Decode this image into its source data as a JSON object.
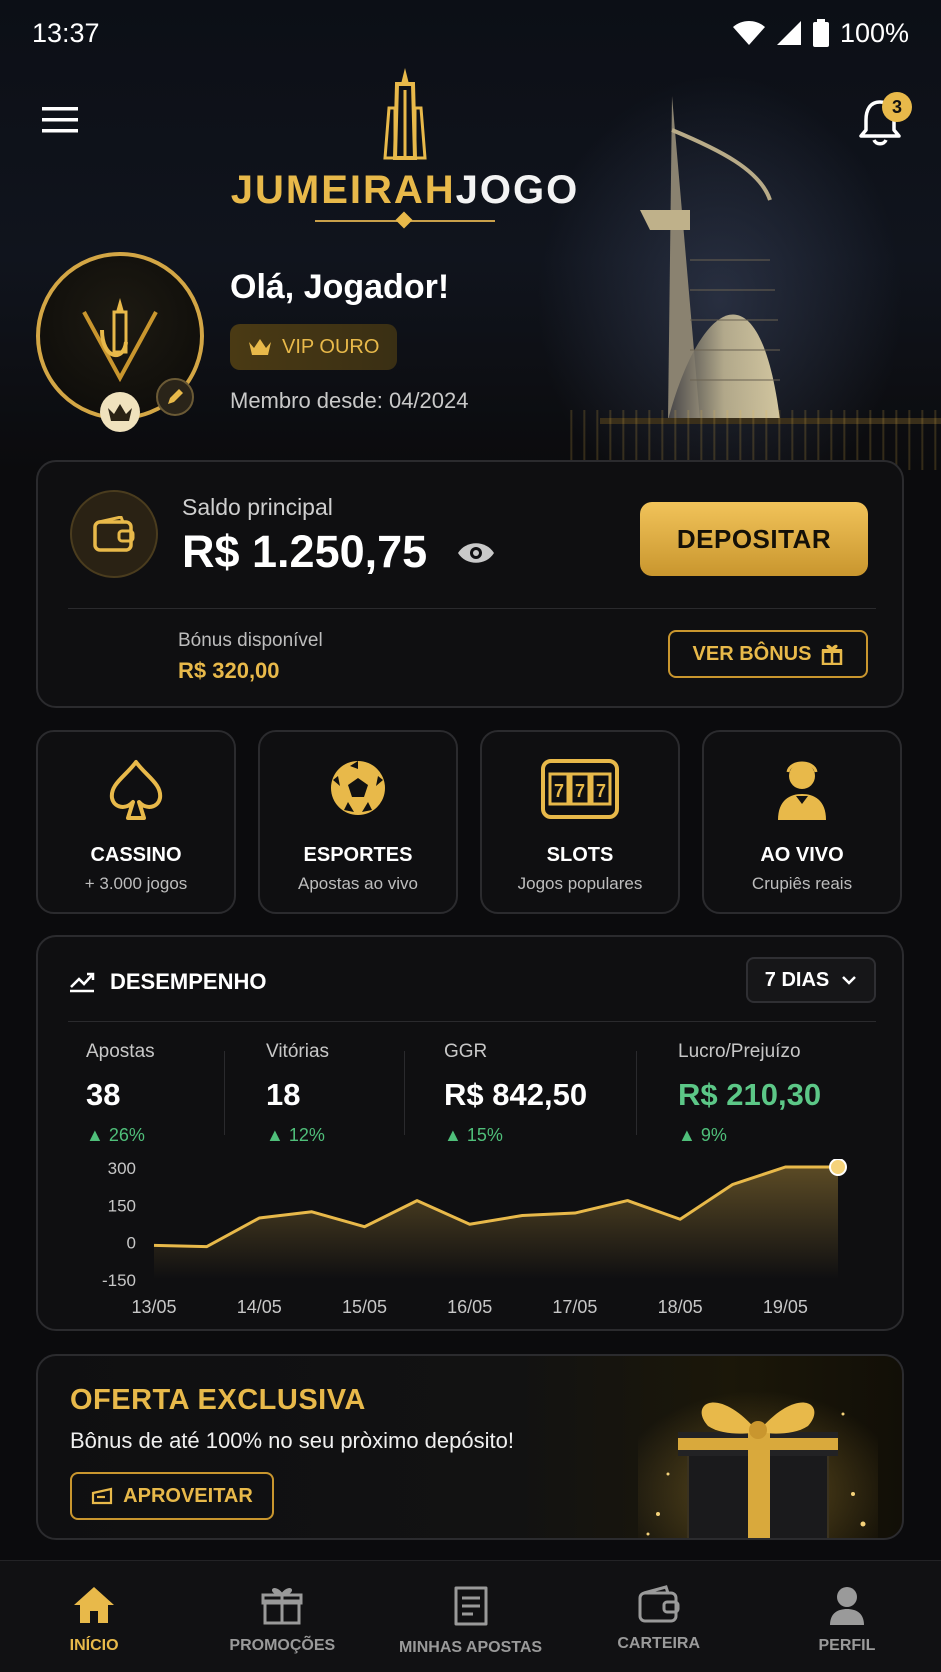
{
  "status_bar": {
    "time": "13:37",
    "battery": "100%"
  },
  "header": {
    "logo_part1": "JUMEIRAH",
    "logo_part2": "JOGO",
    "notification_count": "3"
  },
  "profile": {
    "greeting": "Olá, Jogador!",
    "vip_label": "VIP OURO",
    "member_since": "Membro desde: 04/2024"
  },
  "balance": {
    "label": "Saldo principal",
    "value": "R$ 1.250,75",
    "deposit_label": "DEPOSITAR",
    "bonus_label": "Bónus disponível",
    "bonus_value": "R$ 320,00",
    "view_bonus_label": "VER BÔNUS"
  },
  "categories": [
    {
      "title": "CASSINO",
      "subtitle": "+ 3.000 jogos",
      "icon": "spade-icon"
    },
    {
      "title": "ESPORTES",
      "subtitle": "Apostas ao vivo",
      "icon": "soccer-ball-icon"
    },
    {
      "title": "SLOTS",
      "subtitle": "Jogos populares",
      "icon": "slot-machine-icon"
    },
    {
      "title": "AO VIVO",
      "subtitle": "Crupiês reais",
      "icon": "dealer-icon"
    }
  ],
  "performance": {
    "title": "DESEMPENHO",
    "period": "7 DIAS",
    "stats": [
      {
        "label": "Apostas",
        "value": "38",
        "change": "26%"
      },
      {
        "label": "Vitórias",
        "value": "18",
        "change": "12%"
      },
      {
        "label": "GGR",
        "value": "R$ 842,50",
        "change": "15%"
      },
      {
        "label": "Lucro/Prejuízo",
        "value": "R$ 210,30",
        "change": "9%"
      }
    ]
  },
  "chart_data": {
    "type": "area",
    "title": "",
    "xlabel": "",
    "ylabel": "",
    "ylim": [
      -150,
      300
    ],
    "yticks": [
      300,
      150,
      0,
      -150
    ],
    "x_ticks": [
      "13/05",
      "14/05",
      "15/05",
      "16/05",
      "17/05",
      "18/05",
      "19/05"
    ],
    "x": [
      0,
      0.5,
      1,
      1.5,
      2,
      2.5,
      3,
      3.5,
      4,
      4.5,
      5,
      5.5,
      6,
      6.5
    ],
    "series": [
      {
        "values": [
          -15,
          -20,
          95,
          120,
          60,
          165,
          70,
          105,
          115,
          165,
          90,
          230,
          300,
          300
        ]
      }
    ],
    "grid": false,
    "line_color": "#e8b94a"
  },
  "offer": {
    "title": "OFERTA EXCLUSIVA",
    "subtitle": "Bônus de até 100% no seu pròximo depósito!",
    "button_label": "APROVEITAR"
  },
  "nav": [
    {
      "label": "INÍCIO",
      "icon": "home-icon",
      "active": true
    },
    {
      "label": "PROMOÇÕES",
      "icon": "gift-icon",
      "active": false
    },
    {
      "label": "MINHAS APOSTAS",
      "icon": "betslip-icon",
      "active": false
    },
    {
      "label": "CARTEIRA",
      "icon": "wallet-icon",
      "active": false
    },
    {
      "label": "PERFIL",
      "icon": "user-icon",
      "active": false
    }
  ],
  "colors": {
    "accent": "#e8b94a",
    "positive": "#4fbf7a",
    "background": "#0b0b0d"
  }
}
